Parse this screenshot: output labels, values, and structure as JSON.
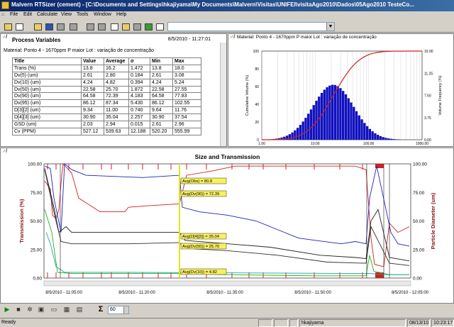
{
  "window": {
    "title": "Malvern RTSizer (cement) - [C:\\Documents and Settings\\hkajiyama\\My Documents\\Malvern\\Visitas\\UNIFEI\\visitaAgo2010\\Dados\\05Ago2010 TesteCo..."
  },
  "menu": [
    "File",
    "Edit",
    "Calculate",
    "View",
    "Tools",
    "Window",
    "Help"
  ],
  "toolbar": {
    "profile_value": ""
  },
  "process_variables": {
    "title": "Process Variables",
    "timestamp": "8/5/2010 - 11:27:01",
    "material": "Material: Ponto 4 - 1670ppm P maior     Lot : variação de concentração",
    "columns": [
      "Title",
      "Value",
      "Average",
      "σ",
      "Min",
      "Max"
    ],
    "rows": [
      [
        "Trans (%)",
        "13.8",
        "16.2",
        "1.472",
        "13.8",
        "18.0"
      ],
      [
        "Dv(5) (um)",
        "2.61",
        "2.80",
        "0.184",
        "2.61",
        "3.08"
      ],
      [
        "Dv(10) (um)",
        "4.24",
        "4.82",
        "0.394",
        "4.24",
        "5.24"
      ],
      [
        "Dv(50) (um)",
        "22.58",
        "25.70",
        "1.872",
        "22.58",
        "27.55"
      ],
      [
        "Dv(90) (um)",
        "64.58",
        "72.39",
        "4.183",
        "64.58",
        "77.83"
      ],
      [
        "Dv(95) (um)",
        "86.12",
        "87.34",
        "5.430",
        "86.12",
        "102.55"
      ],
      [
        "D[3][2] (um)",
        "9.34",
        "11.00",
        "0.740",
        "9.64",
        "11.76"
      ],
      [
        "D[4][3] (um)",
        "30.90",
        "35.04",
        "2.257",
        "30.90",
        "37.54"
      ],
      [
        "GSD (um)",
        "2.03",
        "2.94",
        "0.015",
        "2.61",
        "2.96"
      ],
      [
        "Cv (PPM)",
        "527.12",
        "539.63",
        "12.188",
        "520.20",
        "555.99"
      ]
    ]
  },
  "psd": {
    "header": "Material: Ponto 4 - 1670ppm P maior     Lot : variação de concentração",
    "y_left_label": "Cumulative Volume (%)",
    "y_right_label": "Volume Frequency (%)",
    "y_left_ticks": [
      "100",
      "80",
      "60",
      "40",
      "20",
      "0"
    ],
    "y_right_ticks": [
      "15.00",
      "11.25",
      "7.50",
      "3.75",
      "0.00"
    ],
    "x_ticks": [
      "1.00",
      "10.00",
      "100.00",
      "1000.00"
    ]
  },
  "trend": {
    "title": "Size and Transmission",
    "y_left_label": "Transmission (%)",
    "y_right_label": "Particle Diameter (um)",
    "y_left_ticks": [
      "100.00",
      "75.00",
      "50.00",
      "25.00",
      "0.00"
    ],
    "y_right_ticks": [
      "100.00",
      "75.00",
      "50.00",
      "25.00",
      "0.00"
    ],
    "x_ticks": [
      "8/5/2010 - 11:05:00",
      "8/5/2010 - 11:20:00",
      "8/5/2010 - 11:35:00",
      "8/5/2010 - 11:50:00",
      "8/5/2010 - 12:05:00"
    ],
    "annotations": [
      "Avg(Obs) = 80.8",
      "Avg(Dv(90)) = 72.39",
      "Avg(D[4][3]) = 35.04",
      "Avg(Dv(50)) = 25.70",
      "Avg(Dv(10)) = 4.82"
    ]
  },
  "transport": {
    "sigma": "Σ",
    "average_count": "60"
  },
  "status": {
    "ready": "Ready",
    "user": "hkajiyama",
    "date": "08/13/10",
    "time": "10:23:17"
  },
  "colors": {
    "trans": "#d02020",
    "dv90": "#2020c0",
    "d43": "#202020",
    "dv50": "#303030",
    "dv10": "#20b020",
    "cursor": "#e8e020",
    "histogram": "#1010c0"
  }
}
